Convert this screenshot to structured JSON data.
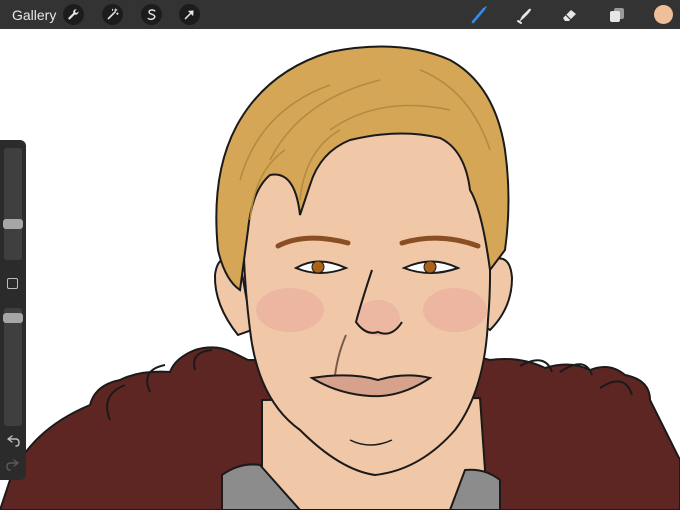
{
  "toolbar": {
    "gallery_label": "Gallery",
    "actions": [
      {
        "name": "wrench-icon"
      },
      {
        "name": "magic-wand-icon"
      },
      {
        "name": "selection-s-icon"
      },
      {
        "name": "arrow-cursor-icon"
      }
    ],
    "tools": [
      {
        "name": "brush-icon",
        "active": true
      },
      {
        "name": "smudge-icon",
        "active": false
      },
      {
        "name": "eraser-icon",
        "active": false
      },
      {
        "name": "layers-icon",
        "active": false
      }
    ],
    "current_color": "#eebf98",
    "active_color": "#2f8cf0"
  },
  "sidebar": {
    "brush_size_level": 0.3,
    "opacity_level": 0.95
  },
  "palette": {
    "hair": "#d4a655",
    "hair_shadow": "#b38a3e",
    "skin": "#f0c8a8",
    "skin_blush": "#eaa89a",
    "cloak": "#5e2622",
    "armor": "#8c8c8c",
    "lips": "#d7a28c",
    "iris": "#a8621c",
    "brow": "#8a4e22"
  }
}
